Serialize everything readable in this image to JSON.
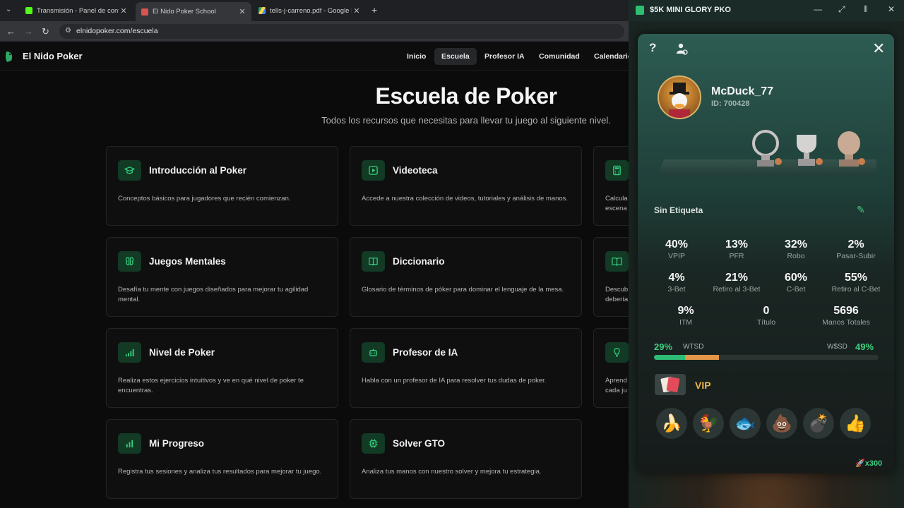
{
  "browser": {
    "tabs": [
      {
        "title": "Transmisión - Panel de control de",
        "favicon_color": "#53fc18"
      },
      {
        "title": "El Nido Poker School",
        "favicon_color": "#d9534f"
      },
      {
        "title": "tells-j-carreno.pdf - Google Drive",
        "favicon_color": "#1fa463"
      }
    ],
    "url": "elnidopoker.com/escuela"
  },
  "site": {
    "brand": "El Nido Poker",
    "nav": [
      "Inicio",
      "Escuela",
      "Profesor IA",
      "Comunidad",
      "Calendario"
    ],
    "active_nav": "Escuela",
    "title": "Escuela de Poker",
    "subtitle": "Todos los recursos que necesitas para llevar tu juego al siguiente nivel.",
    "cards": [
      {
        "title": "Introducción al Poker",
        "desc": "Conceptos básicos para jugadores que recién comienzan.",
        "icon": "graduation-cap-icon"
      },
      {
        "title": "Videoteca",
        "desc": "Accede a nuestra colección de videos, tutoriales y análisis de manos.",
        "icon": "video-icon"
      },
      {
        "title": "",
        "desc": "Calcula\nescena",
        "icon": "calculator-icon"
      },
      {
        "title": "Juegos Mentales",
        "desc": "Desafía tu mente con juegos diseñados para mejorar tu agilidad mental.",
        "icon": "brain-icon"
      },
      {
        "title": "Diccionario",
        "desc": "Glosario de términos de póker para dominar el lenguaje de la mesa.",
        "icon": "book-icon"
      },
      {
        "title": "",
        "desc": "Descub\ndebería",
        "icon": "open-book-icon"
      },
      {
        "title": "Nivel de Poker",
        "desc": "Realiza estos ejercicios intuitivos y ve en qué nivel de poker te encuentras.",
        "icon": "signal-icon"
      },
      {
        "title": "Profesor de IA",
        "desc": "Habla con un profesor de IA para resolver tus dudas de poker.",
        "icon": "robot-icon"
      },
      {
        "title": "",
        "desc": "Aprend\ncada ju",
        "icon": "lightbulb-icon"
      },
      {
        "title": "Mi Progreso",
        "desc": "Registra tus sesiones y analiza tus resultados para mejorar tu juego.",
        "icon": "bar-chart-icon"
      },
      {
        "title": "Solver GTO",
        "desc": "Analiza tus manos con nuestro solver y mejora tu estrategia.",
        "icon": "chip-icon"
      }
    ]
  },
  "client": {
    "window_title": "$5K MINI GLORY PKO",
    "player": {
      "name": "McDuck_77",
      "id": "ID: 700428"
    },
    "tag": "Sin Etiqueta",
    "stats": [
      {
        "value": "40%",
        "label": "VPIP"
      },
      {
        "value": "13%",
        "label": "PFR"
      },
      {
        "value": "32%",
        "label": "Robo"
      },
      {
        "value": "2%",
        "label": "Pasar-Subir"
      },
      {
        "value": "4%",
        "label": "3-Bet"
      },
      {
        "value": "21%",
        "label": "Retiro al 3-Bet"
      },
      {
        "value": "60%",
        "label": "C-Bet"
      },
      {
        "value": "55%",
        "label": "Retiro al C-Bet"
      },
      {
        "value": "9%",
        "label": "ITM"
      },
      {
        "value": "0",
        "label": "Título"
      },
      {
        "value": "5696",
        "label": "Manos Totales"
      }
    ],
    "wtsd": {
      "value": "29%",
      "label": "WTSD"
    },
    "wsd": {
      "value": "49%",
      "label": "W$SD"
    },
    "vip_label": "VIP",
    "emotes": [
      "banana-emote",
      "rooster-emote",
      "fish-emote",
      "poop-emote",
      "bomb-emote",
      "thumbs-up-emote"
    ],
    "emote_glyphs": [
      "🍌",
      "🐓",
      "🐟",
      "💩",
      "💣",
      "👍"
    ],
    "multiplier": "x300",
    "colors": {
      "accent": "#2dbd74",
      "orange": "#e39648",
      "vip": "#e9b54b"
    }
  }
}
